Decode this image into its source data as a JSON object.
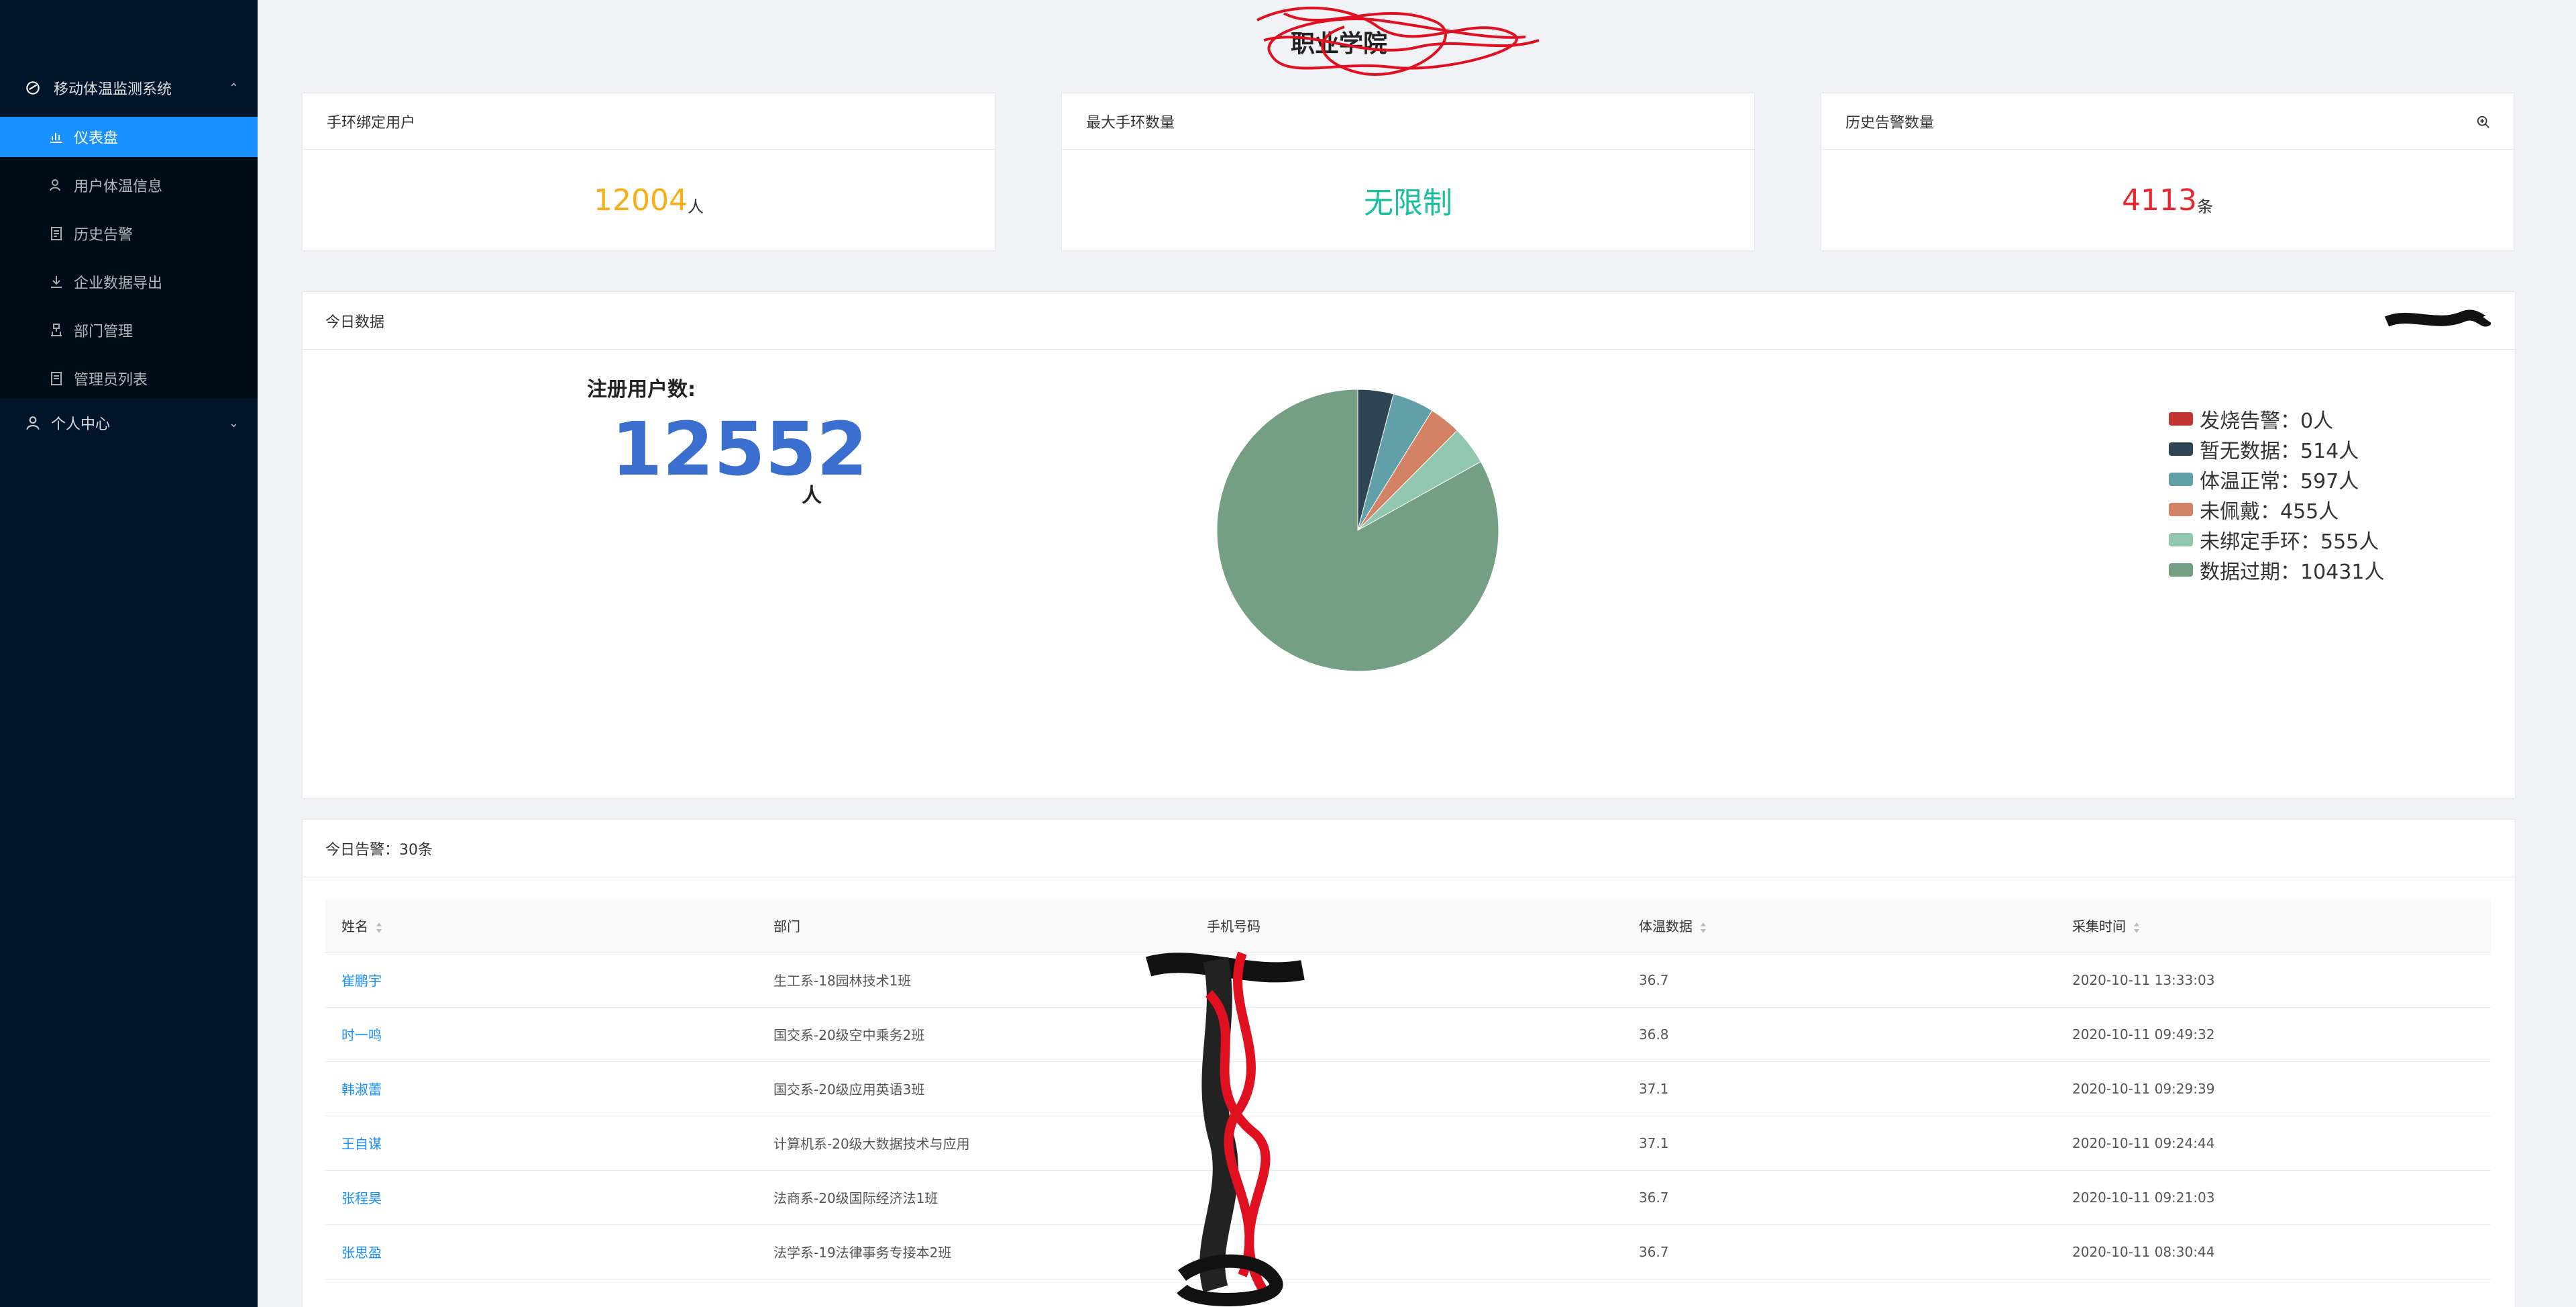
{
  "sidebar": {
    "group1": {
      "label": "移动体温监测系统",
      "icon": "dashboard-group-icon"
    },
    "items": [
      {
        "label": "仪表盘",
        "icon": "bar-chart-icon",
        "active": true
      },
      {
        "label": "用户体温信息",
        "icon": "user-temp-icon"
      },
      {
        "label": "历史告警",
        "icon": "history-icon"
      },
      {
        "label": "企业数据导出",
        "icon": "download-icon"
      },
      {
        "label": "部门管理",
        "icon": "org-icon"
      },
      {
        "label": "管理员列表",
        "icon": "list-icon"
      }
    ],
    "group2": {
      "label": "个人中心",
      "icon": "user-icon"
    }
  },
  "header": {
    "title": "职业学院"
  },
  "cards": [
    {
      "title": "手环绑定用户",
      "value": "12004",
      "unit": "人",
      "color": "#faad14"
    },
    {
      "title": "最大手环数量",
      "value": "无限制",
      "unit": "",
      "color": "#19be9c"
    },
    {
      "title": "历史告警数量",
      "value": "4113",
      "unit": "条",
      "color": "#e8262d"
    }
  ],
  "today": {
    "title": "今日数据",
    "reg_label": "注册用户数:",
    "reg_value": "12552",
    "reg_unit": "人"
  },
  "chart_data": {
    "type": "pie",
    "categories": [
      "发烧告警",
      "暂无数据",
      "体温正常",
      "未佩戴",
      "未绑定手环",
      "数据过期"
    ],
    "values": [
      0,
      514,
      597,
      455,
      555,
      10431
    ],
    "colors": [
      "#c23531",
      "#2f4554",
      "#61a0a8",
      "#d48265",
      "#91c7ae",
      "#749f83"
    ],
    "legend_labels": [
      "发烧告警：0人",
      "暂无数据：514人",
      "体温正常：597人",
      "未佩戴：455人",
      "未绑定手环：555人",
      "数据过期：10431人"
    ],
    "legend": "right"
  },
  "alerts": {
    "title": "今日告警：30条",
    "columns": [
      "姓名",
      "部门",
      "手机号码",
      "体温数据",
      "采集时间"
    ],
    "rows": [
      {
        "name": "崔鹏宇",
        "dept": "生工系-18园林技术1班",
        "phone": "",
        "temp": "36.7",
        "time": "2020-10-11 13:33:03"
      },
      {
        "name": "时一鸣",
        "dept": "国交系-20级空中乘务2班",
        "phone": "1",
        "temp": "36.8",
        "time": "2020-10-11 09:49:32"
      },
      {
        "name": "韩淑蕾",
        "dept": "国交系-20级应用英语3班",
        "phone": "1",
        "temp": "37.1",
        "time": "2020-10-11 09:29:39"
      },
      {
        "name": "王自谋",
        "dept": "计算机系-20级大数据技术与应用",
        "phone": "",
        "temp": "37.1",
        "time": "2020-10-11 09:24:44"
      },
      {
        "name": "张程昊",
        "dept": "法商系-20级国际经济法1班",
        "phone": "",
        "temp": "36.7",
        "time": "2020-10-11 09:21:03"
      },
      {
        "name": "张思盈",
        "dept": "法学系-19法律事务专接本2班",
        "phone": "",
        "temp": "36.7",
        "time": "2020-10-11 08:30:44"
      }
    ]
  }
}
